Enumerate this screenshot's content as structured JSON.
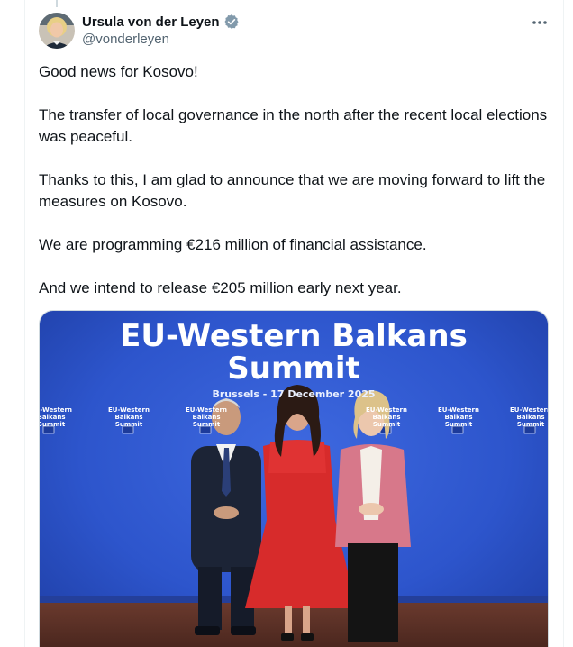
{
  "author": {
    "name": "Ursula von der Leyen",
    "handle": "@vonderleyen"
  },
  "tweet": {
    "paragraphs": [
      "Good news for Kosovo!",
      "The transfer of local governance in the north after the recent local elections was peaceful.",
      "Thanks to this, I am glad to announce that we are moving forward to lift the measures on Kosovo.",
      "We are programming €216 million of financial assistance.",
      "And we intend to release €205 million early next year."
    ]
  },
  "media": {
    "title_line1": "EU-Western Balkans",
    "title_line2": "Summit",
    "subtitle": "Brussels - 17 December 2025",
    "backdrop_label_line1": "EU-Western Balkans",
    "backdrop_label_line2": "Summit"
  },
  "icons": {
    "verified": "verified-badge-icon",
    "more": "more-options-icon"
  },
  "colors": {
    "text": "#0f1419",
    "secondary": "#536471",
    "backdrop_blue": "#2f54c9"
  }
}
